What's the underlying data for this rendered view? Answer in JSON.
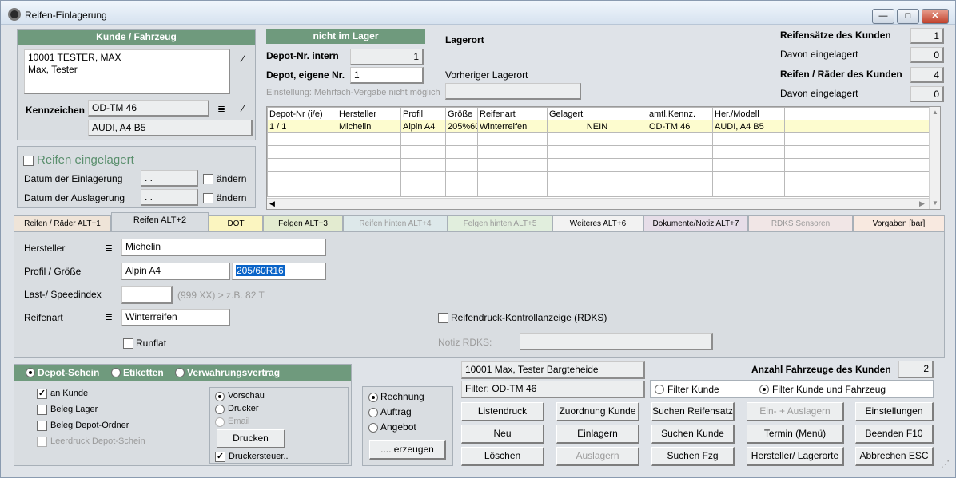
{
  "window": {
    "title": "Reifen-Einlagerung",
    "controls": {
      "minimize": "—",
      "maximize": "□",
      "close": "✕"
    }
  },
  "customer": {
    "header": "Kunde / Fahrzeug",
    "address_line1": "10001 TESTER, MAX",
    "address_line2": "Max, Tester",
    "plate_label": "Kennzeichen",
    "plate_value": "OD-TM 46",
    "vehicle": "AUDI, A4 B5"
  },
  "storage": {
    "checkbox_label": "Reifen eingelagert",
    "date_in_label": "Datum der Einlagerung",
    "date_in_value": ". .",
    "date_out_label": "Datum der Auslagerung",
    "date_out_value": ". .",
    "change_label": "ändern"
  },
  "depot": {
    "status_header": "nicht im Lager",
    "internal_label": "Depot-Nr. intern",
    "internal_value": "1",
    "own_label": "Depot, eigene Nr.",
    "own_value": "1",
    "setting_note": "Einstellung: Mehrfach-Vergabe nicht möglich",
    "location_label": "Lagerort",
    "previous_location_label": "Vorheriger Lagerort",
    "previous_location_value": ""
  },
  "stats": [
    {
      "label": "Reifensätze des Kunden",
      "bold": true,
      "value": "1"
    },
    {
      "label": "Davon eingelagert",
      "bold": false,
      "value": "0"
    },
    {
      "label": "Reifen / Räder des Kunden",
      "bold": true,
      "value": "4"
    },
    {
      "label": "Davon eingelagert",
      "bold": false,
      "value": "0"
    }
  ],
  "grid": {
    "columns": [
      "Depot-Nr (i/e)",
      "Hersteller",
      "Profil",
      "Größe",
      "Reifenart",
      "Gelagert",
      "amtl.Kennz.",
      "Her./Modell",
      ""
    ],
    "rows": [
      [
        "1 / 1",
        "Michelin",
        "Alpin A4",
        "205%60",
        "Winterreifen",
        "NEIN",
        "OD-TM 46",
        "AUDI, A4 B5",
        ""
      ]
    ],
    "empty_rows": 5
  },
  "tabs": [
    {
      "label": "Reifen / Räder ALT+1",
      "color": "#efe4d8"
    },
    {
      "label": "Reifen ALT+2",
      "color": "#d9dde1",
      "active": true
    },
    {
      "label": "DOT",
      "color": "#fbf5c0"
    },
    {
      "label": "Felgen ALT+3",
      "color": "#e3ebd0"
    },
    {
      "label": "Reifen hinten ALT+4",
      "color": "#dde8ea",
      "disabled": true
    },
    {
      "label": "Felgen hinten ALT+5",
      "color": "#e1eedd",
      "disabled": true
    },
    {
      "label": "Weiteres ALT+6",
      "color": "#f2f2f2"
    },
    {
      "label": "Dokumente/Notiz ALT+7",
      "color": "#e6dde8"
    },
    {
      "label": "RDKS Sensoren",
      "color": "#f1e6e6",
      "disabled": true
    },
    {
      "label": "Vorgaben [bar]",
      "color": "#f8e9e0"
    }
  ],
  "tire": {
    "manufacturer_label": "Hersteller",
    "manufacturer_value": "Michelin",
    "profile_label": "Profil / Größe",
    "profile_value": "Alpin A4",
    "size_value": "205/60R16",
    "load_label": "Last-/ Speedindex",
    "load_value": "",
    "load_hint": "(999 XX) > z.B. 82 T",
    "type_label": "Reifenart",
    "type_value": "Winterreifen",
    "runflat_label": "Runflat",
    "rdks_label": "Reifendruck-Kontrollanzeige (RDKS)",
    "rdks_note_label": "Notiz RDKS:",
    "rdks_note_value": ""
  },
  "print": {
    "mode_depot": "Depot-Schein",
    "mode_labels": "Etiketten",
    "mode_contract": "Verwahrungsvertrag",
    "opt_customer": "an Kunde",
    "opt_storage": "Beleg Lager",
    "opt_folder": "Beleg Depot-Ordner",
    "opt_blank": "Leerdruck Depot-Schein",
    "out_preview": "Vorschau",
    "out_printer": "Drucker",
    "out_email": "Email",
    "print_button": "Drucken",
    "print_control": "Druckersteuer..",
    "doc_invoice": "Rechnung",
    "doc_order": "Auftrag",
    "doc_offer": "Angebot",
    "create_button": ".... erzeugen"
  },
  "summary": {
    "customer_line": "10001 Max, Tester Bargteheide",
    "filter_line": "Filter: OD-TM 46",
    "vehicle_count_label": "Anzahl Fahrzeuge des Kunden",
    "vehicle_count_value": "2",
    "filter_customer": "Filter Kunde",
    "filter_customer_vehicle": "Filter Kunde und Fahrzeug"
  },
  "buttons": {
    "list_print": "Listendruck",
    "assign_customer": "Zuordnung Kunde",
    "search_tire_set": "Suchen Reifensatz",
    "in_out": "Ein- + Auslagern",
    "settings": "Einstellungen",
    "new": "Neu",
    "store": "Einlagern",
    "search_customer": "Suchen Kunde",
    "appointment": "Termin (Menü)",
    "exit": "Beenden F10",
    "delete": "Löschen",
    "retrieve": "Auslagern",
    "search_vehicle": "Suchen Fzg",
    "manufacturer_location": "Hersteller/ Lagerorte",
    "cancel": "Abbrechen ESC"
  }
}
